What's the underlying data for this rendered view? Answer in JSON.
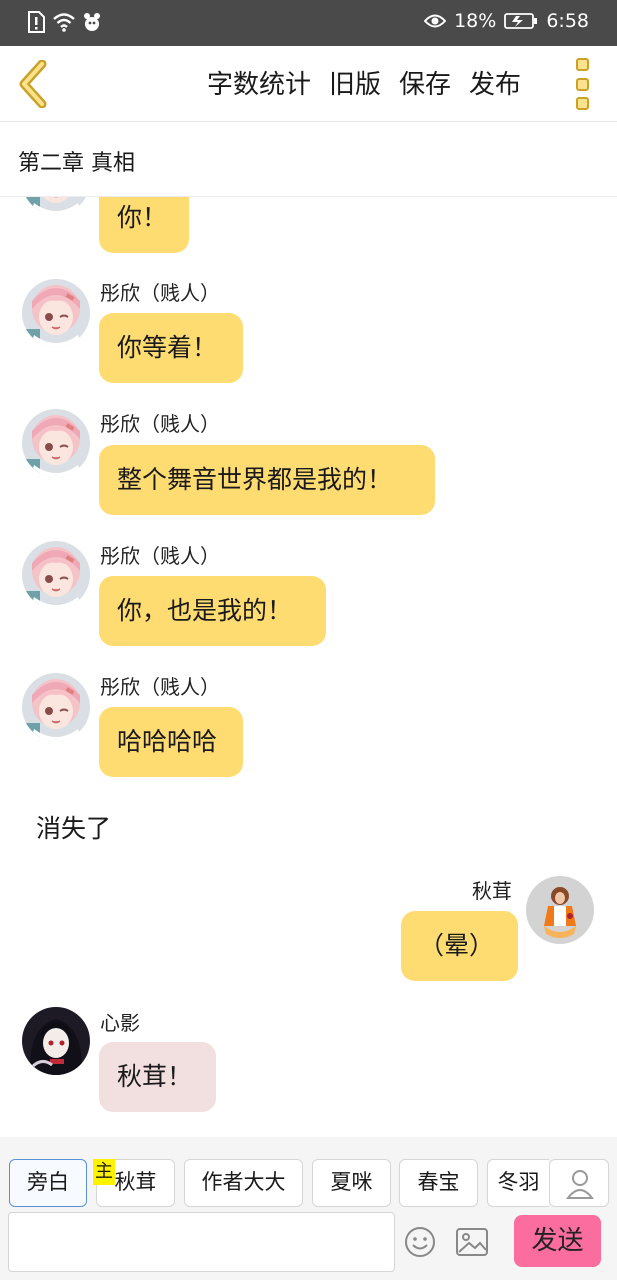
{
  "status_bar": {
    "eye_icon": "eye-icon",
    "battery_percent": "18%",
    "time": "6:58"
  },
  "toolbar": {
    "actions": [
      "字数统计",
      "旧版",
      "保存",
      "发布"
    ]
  },
  "chapter": {
    "title": "第二章   真相"
  },
  "messages": [
    {
      "speaker": "",
      "text": "你！",
      "side": "left",
      "color": "yellow",
      "avatar": "pink-hair-girl"
    },
    {
      "speaker": "彤欣（贱人）",
      "text": "你等着！",
      "side": "left",
      "color": "yellow",
      "avatar": "pink-hair-girl"
    },
    {
      "speaker": "彤欣（贱人）",
      "text": "整个舞音世界都是我的！",
      "side": "left",
      "color": "yellow",
      "avatar": "pink-hair-girl"
    },
    {
      "speaker": "彤欣（贱人）",
      "text": "你，也是我的！",
      "side": "left",
      "color": "yellow",
      "avatar": "pink-hair-girl"
    },
    {
      "speaker": "彤欣（贱人）",
      "text": "哈哈哈哈",
      "side": "left",
      "color": "yellow",
      "avatar": "pink-hair-girl"
    }
  ],
  "narration": "消失了",
  "right_message": {
    "speaker": "秋茸",
    "text": "（晕）",
    "color": "yellow",
    "avatar": "orange-dress-girl"
  },
  "last_message": {
    "speaker": "心影",
    "text": "秋茸！",
    "color": "pink",
    "avatar": "dark-hair-girl"
  },
  "roles": {
    "main_tag": "主",
    "items": [
      "旁白",
      "秋茸",
      "作者大大",
      "夏咪",
      "春宝",
      "冬羽"
    ]
  },
  "input": {
    "value": "",
    "send_label": "发送"
  },
  "colors": {
    "bubble_yellow": "#ffdc72",
    "bubble_pink": "#f2dfe0",
    "send_button": "#fb6d9e",
    "status_bar": "#4a4a4a",
    "accent_gold": "#c9a227"
  }
}
